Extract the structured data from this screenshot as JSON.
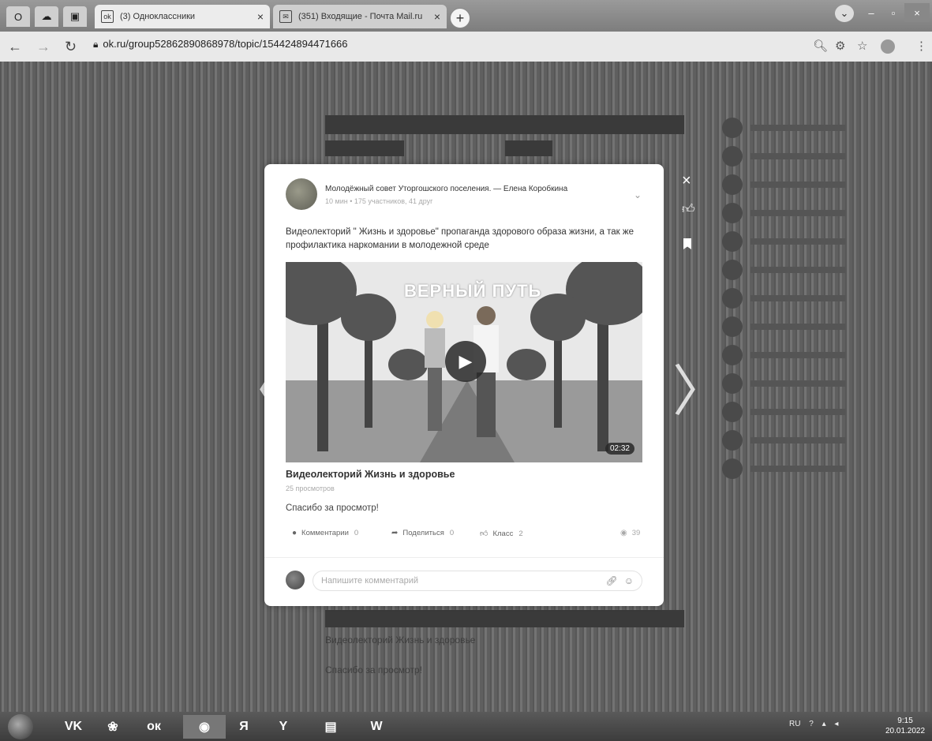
{
  "browser": {
    "tabs": [
      {
        "title": "(3) Одноклассники",
        "icon": "ok-favicon"
      },
      {
        "title": "(351) Входящие - Почта Mail.ru",
        "icon": "mail-favicon"
      }
    ],
    "url": "ok.ru/group52862890868978/topic/154424894471666"
  },
  "post": {
    "author": "Молодёжный совет Уторгошского поселения. — Елена Коробкина",
    "meta": "10 мин • 175 участников, 41 друг",
    "text": "Видеолекторий \" Жизнь и здоровье\" пропаганда здорового образа жизни, а так же профилактика наркомании в молодежной среде",
    "video": {
      "overlay_title": "ВЕРНЫЙ ПУТЬ",
      "duration": "02:32",
      "title": "Видеолекторий Жизнь и здоровье",
      "views": "25 просмотров"
    },
    "caption": "Спасибо за просмотр!",
    "actions": {
      "comments_label": "Комментарии",
      "comments_count": "0",
      "share_label": "Поделиться",
      "share_count": "0",
      "like_label": "Класс",
      "like_count": "2",
      "views_count": "39"
    },
    "comment_placeholder": "Напишите комментарий"
  },
  "background": {
    "lower_title": "Видеолекторий Жизнь и здоровье",
    "lower_caption": "Спасибо за просмотр!"
  },
  "taskbar": {
    "lang": "RU",
    "time": "9:15",
    "date": "20.01.2022"
  }
}
